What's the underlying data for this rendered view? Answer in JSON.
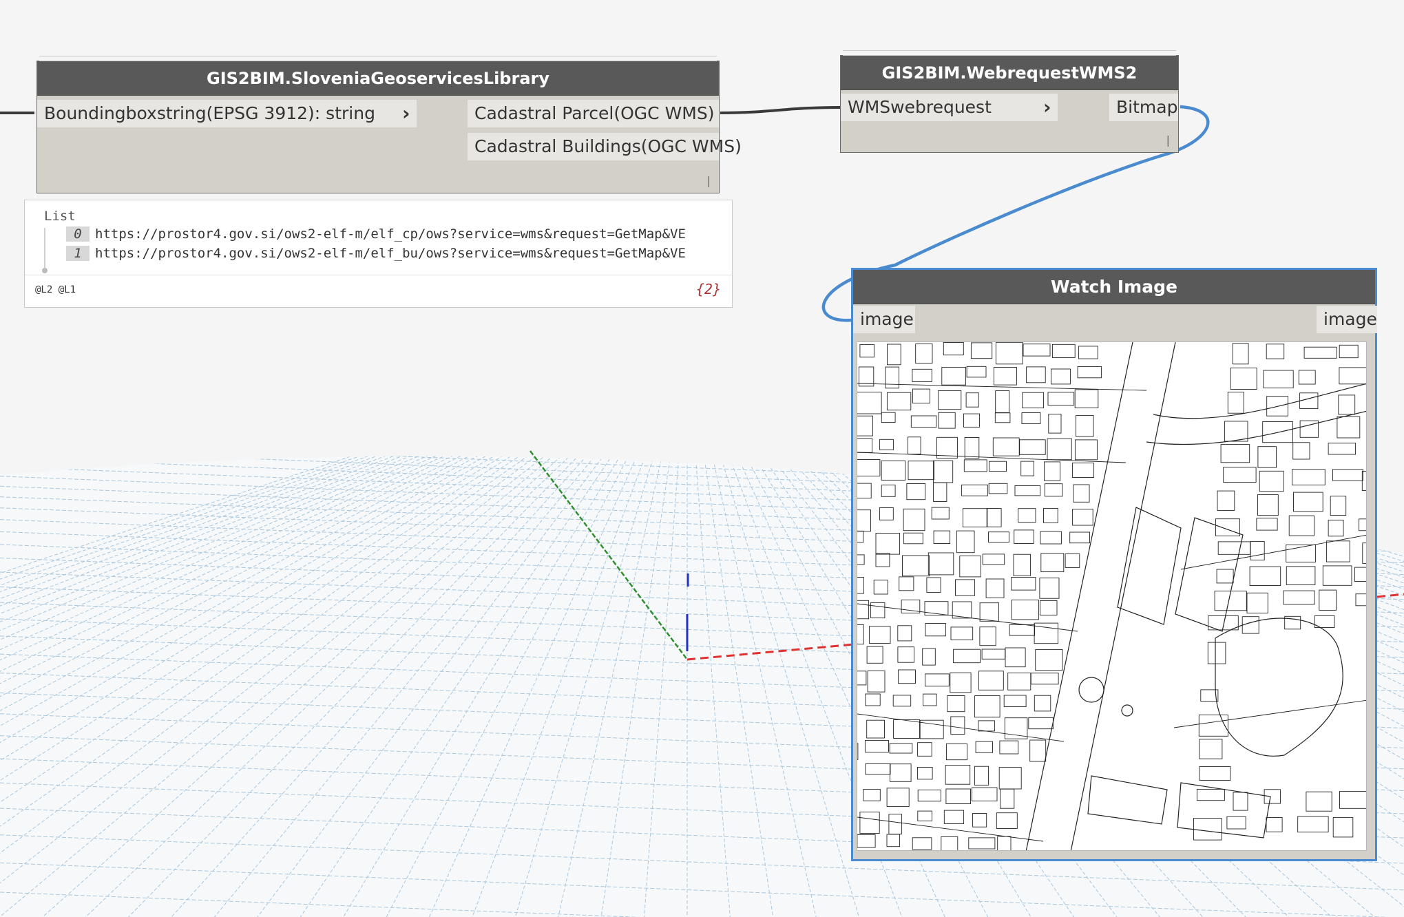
{
  "nodes": {
    "slovenia": {
      "title": "GIS2BIM.SloveniaGeoservicesLibrary",
      "input": "Boundingboxstring(EPSG 3912): string",
      "outputs": [
        "Cadastral Parcel(OGC WMS)",
        "Cadastral Buildings(OGC WMS)"
      ]
    },
    "webrequest": {
      "title": "GIS2BIM.WebrequestWMS2",
      "input": "WMSwebrequest",
      "output": "Bitmap"
    },
    "watch": {
      "title": "Watch Image",
      "input": "image",
      "output": "image"
    }
  },
  "preview": {
    "header": "List",
    "items": [
      {
        "index": "0",
        "value": "https://prostor4.gov.si/ows2-elf-m/elf_cp/ows?service=wms&request=GetMap&VE"
      },
      {
        "index": "1",
        "value": "https://prostor4.gov.si/ows2-elf-m/elf_bu/ows?service=wms&request=GetMap&VE"
      }
    ],
    "levels": "@L2 @L1",
    "count": "{2}"
  },
  "colors": {
    "node_header": "#595959",
    "node_body": "#d3cfc9",
    "wire": "#3a3a3a",
    "selected_wire": "#4a8bd0",
    "grid": "#a9c7dd",
    "axis_x": "#e03030",
    "axis_y": "#2f8f2f",
    "axis_z": "#2030c0"
  },
  "icons": {
    "chevron": "chevron-right-icon",
    "resize": "resize-handle-icon"
  }
}
